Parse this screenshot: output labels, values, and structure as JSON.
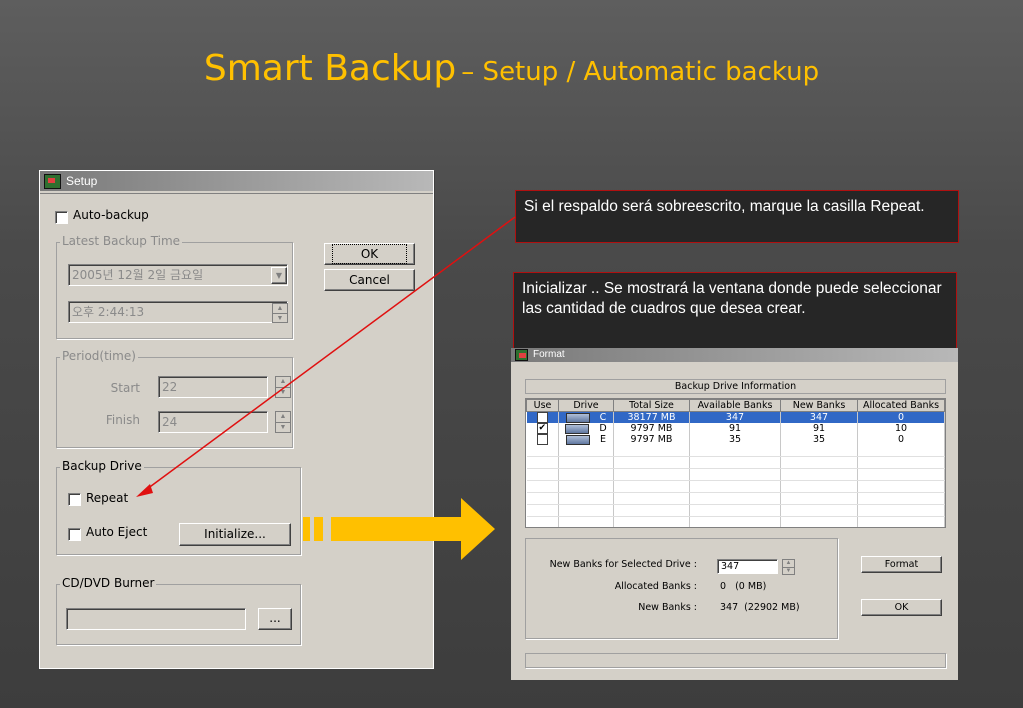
{
  "slide": {
    "title_main": "Smart Backup",
    "title_sub": "– Setup / Automatic backup"
  },
  "setup_window": {
    "title": "Setup",
    "auto_backup_label": "Auto-backup",
    "latest_backup_group": "Latest Backup Time",
    "date_value": "2005년 12월  2일 금요일",
    "time_value": "오후  2:44:13",
    "ok_label": "OK",
    "cancel_label": "Cancel",
    "period_group": "Period(time)",
    "start_label": "Start",
    "start_value": "22",
    "finish_label": "Finish",
    "finish_value": "24",
    "backup_drive_group": "Backup Drive",
    "repeat_label": "Repeat",
    "auto_eject_label": "Auto Eject",
    "initialize_label": "Initialize...",
    "burner_group": "CD/DVD Burner",
    "burner_value": "",
    "browse_label": "..."
  },
  "callouts": {
    "repeat_note": "Si el respaldo será sobreescrito, marque la casilla Repeat.",
    "initialize_note": "Inicializar .. Se mostrará la ventana donde puede seleccionar las cantidad de cuadros que desea crear."
  },
  "format_window": {
    "title": "Format",
    "info_header": "Backup Drive Information",
    "columns": [
      "Use",
      "Drive",
      "Total Size",
      "Available Banks",
      "New Banks",
      "Allocated Banks"
    ],
    "rows": [
      {
        "use": false,
        "drive": "C",
        "total": "38177 MB",
        "available": "347",
        "new": "347",
        "allocated": "0",
        "selected": true
      },
      {
        "use": true,
        "drive": "D",
        "total": "9797 MB",
        "available": "91",
        "new": "91",
        "allocated": "10",
        "selected": false
      },
      {
        "use": false,
        "drive": "E",
        "total": "9797 MB",
        "available": "35",
        "new": "35",
        "allocated": "0",
        "selected": false
      }
    ],
    "new_banks_selected_label": "New Banks for Selected Drive :",
    "new_banks_selected_value": "347",
    "allocated_banks_label": "Allocated Banks :",
    "allocated_banks_value": "0   (0 MB)",
    "new_banks_label": "New Banks :",
    "new_banks_value": "347  (22902 MB)",
    "format_button": "Format",
    "ok_button": "OK"
  },
  "colors": {
    "title": "#ffc000",
    "arrow": "#ffc000",
    "callout_border": "#b01010",
    "pointer_line": "#e01010",
    "selection": "#3168c6"
  }
}
